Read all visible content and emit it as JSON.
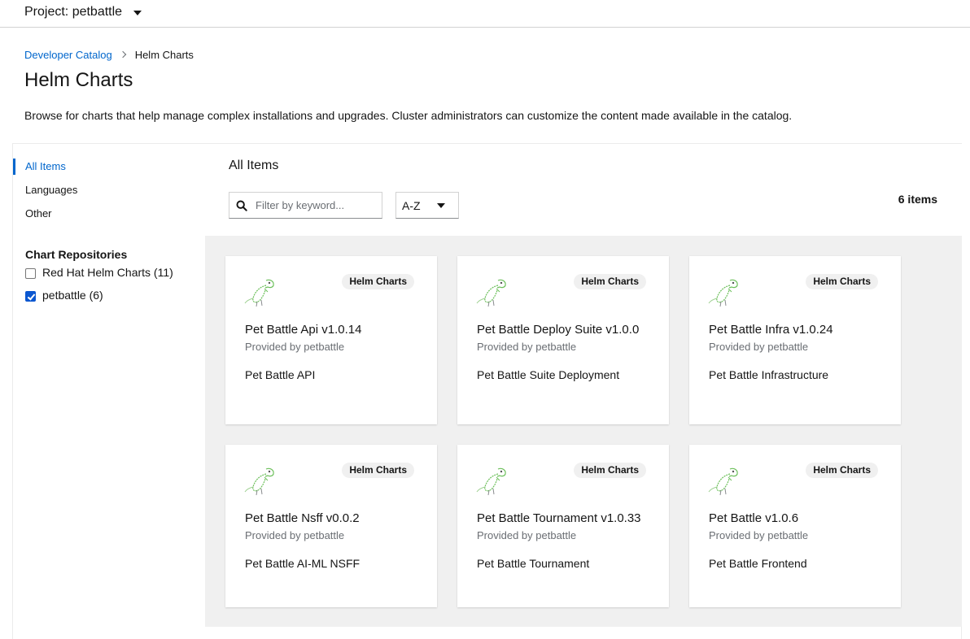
{
  "project": {
    "label": "Project: petbattle"
  },
  "breadcrumb": {
    "parent": "Developer Catalog",
    "current": "Helm Charts"
  },
  "page": {
    "title": "Helm Charts",
    "description": "Browse for charts that help manage complex installations and upgrades. Cluster administrators can customize the content made available in the catalog."
  },
  "sidebar": {
    "categories": [
      {
        "label": "All Items",
        "active": true
      },
      {
        "label": "Languages",
        "active": false
      },
      {
        "label": "Other",
        "active": false
      }
    ],
    "repositories_heading": "Chart Repositories",
    "repositories": [
      {
        "label": "Red Hat Helm Charts (11)",
        "checked": false
      },
      {
        "label": "petbattle (6)",
        "checked": true
      }
    ]
  },
  "main": {
    "title": "All Items",
    "search_placeholder": "Filter by keyword...",
    "sort_value": "A-Z",
    "count": "6 items"
  },
  "tiles": [
    {
      "badge": "Helm Charts",
      "title": "Pet Battle Api v1.0.14",
      "provider": "Provided by petbattle",
      "description": "Pet Battle API"
    },
    {
      "badge": "Helm Charts",
      "title": "Pet Battle Deploy Suite v1.0.0",
      "provider": "Provided by petbattle",
      "description": "Pet Battle Suite Deployment"
    },
    {
      "badge": "Helm Charts",
      "title": "Pet Battle Infra v1.0.24",
      "provider": "Provided by petbattle",
      "description": "Pet Battle Infrastructure"
    },
    {
      "badge": "Helm Charts",
      "title": "Pet Battle Nsff v0.0.2",
      "provider": "Provided by petbattle",
      "description": "Pet Battle AI-ML NSFF"
    },
    {
      "badge": "Helm Charts",
      "title": "Pet Battle Tournament v1.0.33",
      "provider": "Provided by petbattle",
      "description": "Pet Battle Tournament"
    },
    {
      "badge": "Helm Charts",
      "title": "Pet Battle v1.0.6",
      "provider": "Provided by petbattle",
      "description": "Pet Battle Frontend"
    }
  ],
  "colors": {
    "link": "#0066cc",
    "accent_check": "#0b57d0",
    "grid_bg": "#f0f0f0",
    "logo_green": "#6bbf59"
  }
}
